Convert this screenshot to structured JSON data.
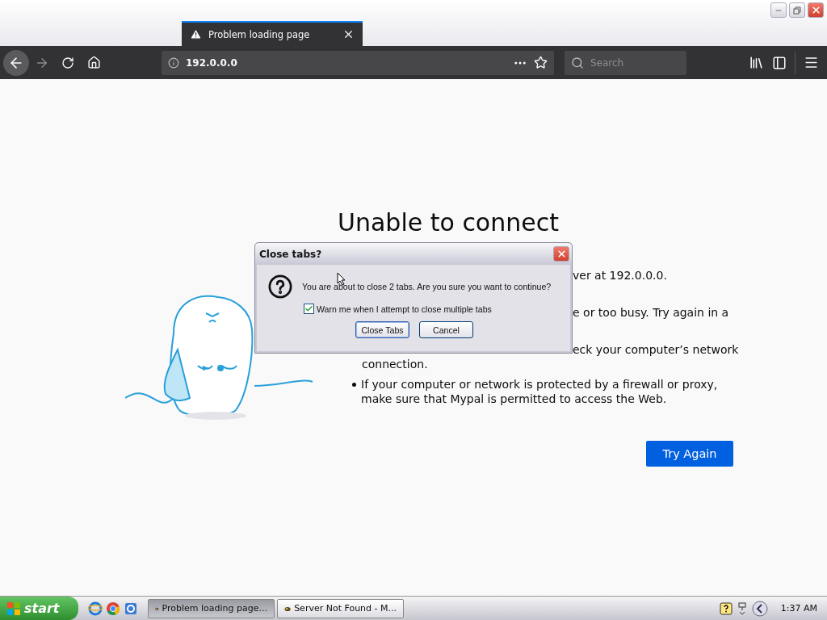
{
  "tabs": [
    {
      "title": "Problem loading page",
      "selected": true
    }
  ],
  "toolbar": {
    "url": "192.0.0.0",
    "search_placeholder": "Search"
  },
  "page": {
    "title": "Unable to connect",
    "items": [
      {
        "kind": "cut",
        "text": "ver at 192.0.0.0."
      },
      {
        "kind": "cut",
        "text": "e or too busy. Try again in a"
      },
      {
        "kind": "cut",
        "text": "eck your computer’s network"
      },
      {
        "kind": "line",
        "text": "connection."
      },
      {
        "kind": "bullet",
        "text": "If your computer or network is protected by a firewall or proxy, make sure that Mypal is permitted to access the Web."
      }
    ],
    "button": "Try Again"
  },
  "dialog": {
    "title": "Close tabs?",
    "message": "You are about to close 2 tabs. Are you sure you want to continue?",
    "checkbox": {
      "label": "Warn me when I attempt to close multiple tabs",
      "checked": true
    },
    "buttons": [
      {
        "label": "Close Tabs",
        "default": true
      },
      {
        "label": "Cancel",
        "default": false
      }
    ]
  },
  "taskbar": {
    "start": "start",
    "tasks": [
      {
        "label": "Problem loading page...",
        "selected": true
      },
      {
        "label": "Server Not Found - M...",
        "selected": false
      }
    ],
    "clock": "1:37 AM"
  }
}
